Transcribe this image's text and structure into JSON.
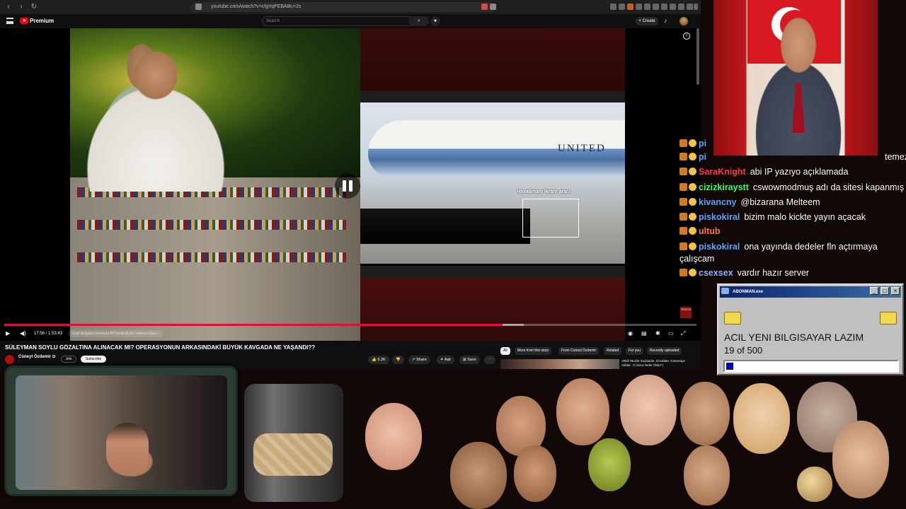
{
  "browser": {
    "url": "youtube.com/watch?v=cfgYqPEBABc=2s"
  },
  "youtube": {
    "brand": "Premium",
    "search_placeholder": "Search",
    "create_label": "+ Create"
  },
  "video": {
    "annotation_label": "Havalimanı İkram aracı",
    "plane_text": "UNITED",
    "time": "17:56 / 1:53:43",
    "chapter": "Uçak değişimi sırasında AP fotoğrafçıları odanın ortası ›",
    "progress_fraction": 0.72,
    "corner_logo": "SÖZCÜ"
  },
  "meta": {
    "title": "SÜLEYMAN SOYLU GÖZALTINA ALINACAK MI? OPERASYONUN ARKASINDAKİ BÜYÜK KAVGADA NE YAŞANDI??",
    "channel": "Cüneyt Özdemir ⊙",
    "subscribers": "",
    "join": "Join",
    "subscribe": "Subscribe",
    "likes": "5.2K",
    "share": "Share",
    "ask": "Ask",
    "save": "Save",
    "chips": [
      "All",
      "More from this story",
      "From Cüneyt Özdemir",
      "Related",
      "For you",
      "Recently uploaded"
    ],
    "rec_title": "Vekili Tacizle Suçladılar, Dövdüler, Kameraya Aldılar.. O Gece Neler Oldu? |"
  },
  "chat": [
    {
      "user": "pi",
      "text": "",
      "color": "#5fa8ff"
    },
    {
      "user": "pi",
      "text": "temez",
      "color": "#5fa8ff"
    },
    {
      "user": "SaraKnight",
      "text": "abi IP yazıyo açıklamada",
      "color": "#ff3b3b"
    },
    {
      "user": "cizizkiraystt",
      "text": "cswowmodmuş adı da sitesi kapanmış",
      "color": "#3bff5c"
    },
    {
      "user": "kivancny",
      "text": "@bizarana Melteem",
      "color": "#5fa8ff"
    },
    {
      "user": "piskokiral",
      "text": "bizim malo kickte yayın açacak",
      "color": "#5fa8ff"
    },
    {
      "user": "ultub",
      "text": "",
      "color": "#ff7a3b"
    },
    {
      "user": "piskokiral",
      "text": "ona yayında dedeler fln açtırmaya",
      "color": "#5fa8ff"
    },
    {
      "user": "",
      "text": "çalışcam",
      "color": "#ffffff"
    },
    {
      "user": "csexsex",
      "text": "vardır hazır server",
      "color": "#9ab0ff"
    }
  ],
  "donation": {
    "window_title": "ABONMAN.exe",
    "heading": "ACIL YENI BILGISAYAR LAZIM",
    "count": "19 of 500",
    "progress_fraction": 0.038
  }
}
